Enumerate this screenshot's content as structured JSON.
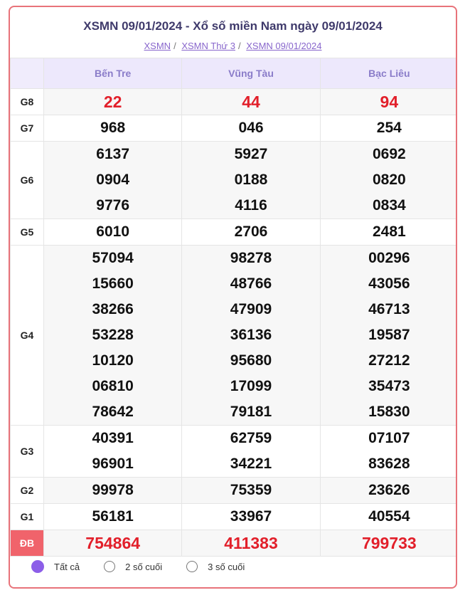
{
  "header": {
    "title": "XSMN 09/01/2024 - Xổ số miền Nam ngày 09/01/2024",
    "breadcrumbs": [
      "XSMN",
      "XSMN Thứ 3",
      "XSMN 09/01/2024"
    ]
  },
  "columns": [
    "Bến Tre",
    "Vũng Tàu",
    "Bạc Liêu"
  ],
  "prizes": [
    {
      "label": "G8",
      "rows": [
        [
          "22",
          "44",
          "94"
        ]
      ]
    },
    {
      "label": "G7",
      "rows": [
        [
          "968",
          "046",
          "254"
        ]
      ]
    },
    {
      "label": "G6",
      "rows": [
        [
          "6137",
          "5927",
          "0692"
        ],
        [
          "0904",
          "0188",
          "0820"
        ],
        [
          "9776",
          "4116",
          "0834"
        ]
      ]
    },
    {
      "label": "G5",
      "rows": [
        [
          "6010",
          "2706",
          "2481"
        ]
      ]
    },
    {
      "label": "G4",
      "rows": [
        [
          "57094",
          "98278",
          "00296"
        ],
        [
          "15660",
          "48766",
          "43056"
        ],
        [
          "38266",
          "47909",
          "46713"
        ],
        [
          "53228",
          "36136",
          "19587"
        ],
        [
          "10120",
          "95680",
          "27212"
        ],
        [
          "06810",
          "17099",
          "35473"
        ],
        [
          "78642",
          "79181",
          "15830"
        ]
      ]
    },
    {
      "label": "G3",
      "rows": [
        [
          "40391",
          "62759",
          "07107"
        ],
        [
          "96901",
          "34221",
          "83628"
        ]
      ]
    },
    {
      "label": "G2",
      "rows": [
        [
          "99978",
          "75359",
          "23626"
        ]
      ]
    },
    {
      "label": "G1",
      "rows": [
        [
          "56181",
          "33967",
          "40554"
        ]
      ]
    },
    {
      "label": "ĐB",
      "rows": [
        [
          "754864",
          "411383",
          "799733"
        ]
      ]
    }
  ],
  "filters": [
    {
      "label": "Tất cả",
      "selected": true
    },
    {
      "label": "2 số cuối",
      "selected": false
    },
    {
      "label": "3 số cuối",
      "selected": false
    }
  ],
  "colors": {
    "accent": "#8c5ee8",
    "special": "#e21f2a",
    "border": "#e8737a"
  }
}
